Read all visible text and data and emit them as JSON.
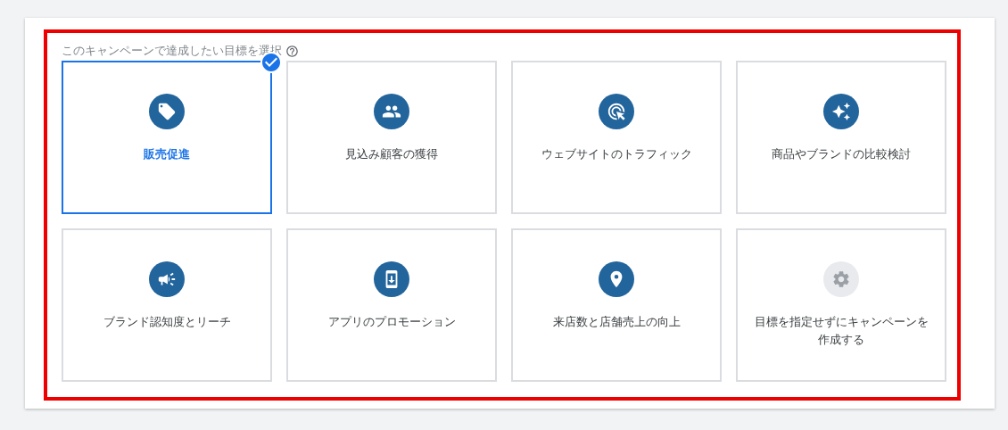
{
  "heading": "このキャンペーンで達成したい目標を選択",
  "goals": [
    {
      "kind": "tag",
      "label": "販売促進",
      "selected": true
    },
    {
      "kind": "people",
      "label": "見込み顧客の獲得",
      "selected": false
    },
    {
      "kind": "click",
      "label": "ウェブサイトのトラフィック",
      "selected": false
    },
    {
      "kind": "sparkle",
      "label": "商品やブランドの比較検討",
      "selected": false
    },
    {
      "kind": "megaphone",
      "label": "ブランド認知度とリーチ",
      "selected": false
    },
    {
      "kind": "phone",
      "label": "アプリのプロモーション",
      "selected": false
    },
    {
      "kind": "pin",
      "label": "来店数と店舗売上の向上",
      "selected": false
    },
    {
      "kind": "gear",
      "label": "目標を指定せずにキャンペーンを作成する",
      "selected": false
    }
  ]
}
